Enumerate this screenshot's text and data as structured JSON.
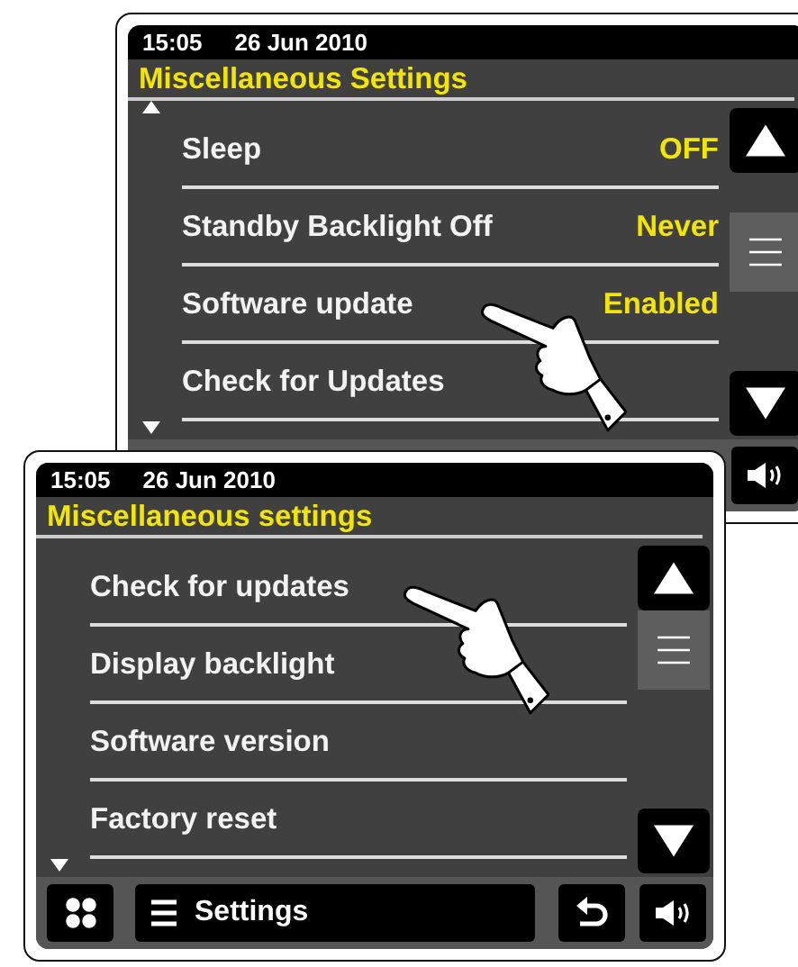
{
  "screens": [
    {
      "time": "15:05",
      "date": "26 Jun 2010",
      "title": "Miscellaneous Settings",
      "more_above": true,
      "more_below": true,
      "rows": [
        {
          "label": "Sleep",
          "value": "OFF",
          "touched": false
        },
        {
          "label": "Standby Backlight Off",
          "value": "Never",
          "touched": false
        },
        {
          "label": "Software update",
          "value": "Enabled",
          "touched": true
        },
        {
          "label": "Check for Updates",
          "touched": false
        }
      ],
      "buttons": [
        {
          "kind": "volume"
        }
      ]
    },
    {
      "time": "15:05",
      "date": "26 Jun 2010",
      "title": "Miscellaneous settings",
      "more_above": false,
      "more_below": true,
      "rows": [
        {
          "label": "Check for updates",
          "touched": true
        },
        {
          "label": "Display backlight",
          "touched": false
        },
        {
          "label": "Software version",
          "touched": false
        },
        {
          "label": "Factory reset",
          "touched": false
        }
      ],
      "buttons": [
        {
          "kind": "apps"
        },
        {
          "kind": "menu",
          "label": "Settings"
        },
        {
          "kind": "back"
        },
        {
          "kind": "volume"
        }
      ]
    }
  ]
}
